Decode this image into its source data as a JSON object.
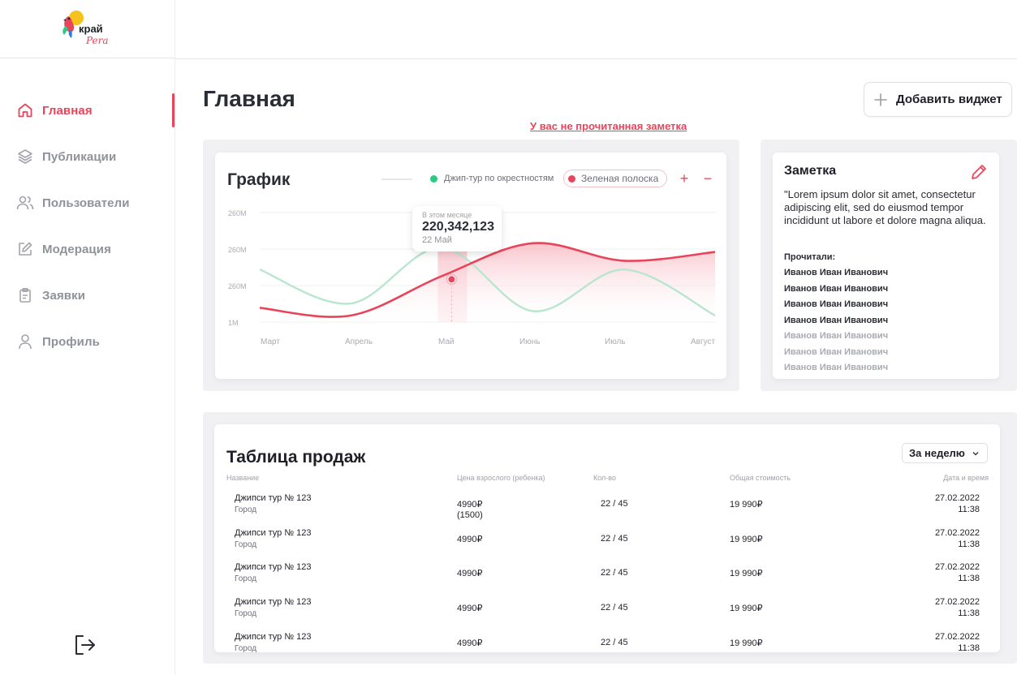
{
  "brand": {
    "logo_text": "край",
    "logo_script": "Pera"
  },
  "sidebar": {
    "items": [
      {
        "label": "Главная",
        "icon": "home-icon",
        "active": true
      },
      {
        "label": "Публикации",
        "icon": "layers-icon",
        "active": false
      },
      {
        "label": "Пользователи",
        "icon": "users-icon",
        "active": false
      },
      {
        "label": "Модерация",
        "icon": "edit-square-icon",
        "active": false
      },
      {
        "label": "Заявки",
        "icon": "clipboard-icon",
        "active": false
      },
      {
        "label": "Профиль",
        "icon": "user-icon",
        "active": false
      }
    ],
    "logout_icon": "logout-icon"
  },
  "header": {
    "title": "Главная",
    "add_widget_label": "Добавить виджет",
    "unread_note_link": "У вас не прочитанная заметка"
  },
  "colors": {
    "accent": "#e8455a",
    "green": "#2ec980",
    "green_line": "#b9e6cf"
  },
  "chart_widget": {
    "title": "График",
    "legend": [
      {
        "name": "Джип-тур по окрестностям",
        "color": "#2ec980"
      },
      {
        "name": "Зеленая полоска",
        "color": "#e8455a"
      }
    ],
    "zoom_in": "+",
    "zoom_out": "−",
    "tooltip": {
      "caption": "В этом месяце",
      "value": "220,342,123",
      "date": "22 Май"
    }
  },
  "chart_data": {
    "type": "area",
    "x": [
      "Март",
      "Апрель",
      "Май",
      "Июнь",
      "Июль",
      "Август"
    ],
    "y_tick_labels": [
      "260M",
      "260M",
      "260M",
      "1M"
    ],
    "grid": true,
    "series": [
      {
        "name": "Джип-тур по окрестностям",
        "style": "line",
        "values": [
          0.48,
          0.17,
          0.68,
          0.1,
          0.48,
          0.06
        ]
      },
      {
        "name": "Зеленая полоска",
        "style": "area",
        "values": [
          0.13,
          0.06,
          0.42,
          0.72,
          0.56,
          0.64
        ]
      }
    ],
    "highlight": {
      "x": "Май",
      "label": "22 Май"
    }
  },
  "note": {
    "title": "Заметка",
    "text": "\"Lorem ipsum dolor sit amet, consectetur adipiscing elit, sed do eiusmod tempor incididunt ut labore et dolore magna aliqua.",
    "readers_label": "Прочитали:",
    "readers": [
      {
        "name": "Иванов Иван Иванович",
        "read": true
      },
      {
        "name": "Иванов Иван Иванович",
        "read": true
      },
      {
        "name": "Иванов Иван Иванович",
        "read": true
      },
      {
        "name": "Иванов Иван Иванович",
        "read": true
      },
      {
        "name": "Иванов Иван Иванович",
        "read": false
      },
      {
        "name": "Иванов Иван Иванович",
        "read": false
      },
      {
        "name": "Иванов Иван Иванович",
        "read": false
      }
    ]
  },
  "sales_table": {
    "title": "Таблица продаж",
    "period": "За неделю",
    "columns": [
      "Название",
      "Цена взрослого (ребенка)",
      "Кол-во",
      "Общая стоимость",
      "Дата и время"
    ],
    "rows": [
      {
        "name": "Джипси тур № 123",
        "city": "Город",
        "price": "4990₽",
        "price_child": "(1500)",
        "qty": "22 / 45",
        "total": "19 990₽",
        "date": "27.02.2022",
        "time": "11:38"
      },
      {
        "name": "Джипси тур № 123",
        "city": "Город",
        "price": "4990₽",
        "price_child": "",
        "qty": "22 / 45",
        "total": "19 990₽",
        "date": "27.02.2022",
        "time": "11:38"
      },
      {
        "name": "Джипси тур № 123",
        "city": "Город",
        "price": "4990₽",
        "price_child": "",
        "qty": "22 / 45",
        "total": "19 990₽",
        "date": "27.02.2022",
        "time": "11:38"
      },
      {
        "name": "Джипси тур № 123",
        "city": "Город",
        "price": "4990₽",
        "price_child": "",
        "qty": "22 / 45",
        "total": "19 990₽",
        "date": "27.02.2022",
        "time": "11:38"
      },
      {
        "name": "Джипси тур № 123",
        "city": "Город",
        "price": "4990₽",
        "price_child": "",
        "qty": "22 / 45",
        "total": "19 990₽",
        "date": "27.02.2022",
        "time": "11:38"
      }
    ]
  }
}
